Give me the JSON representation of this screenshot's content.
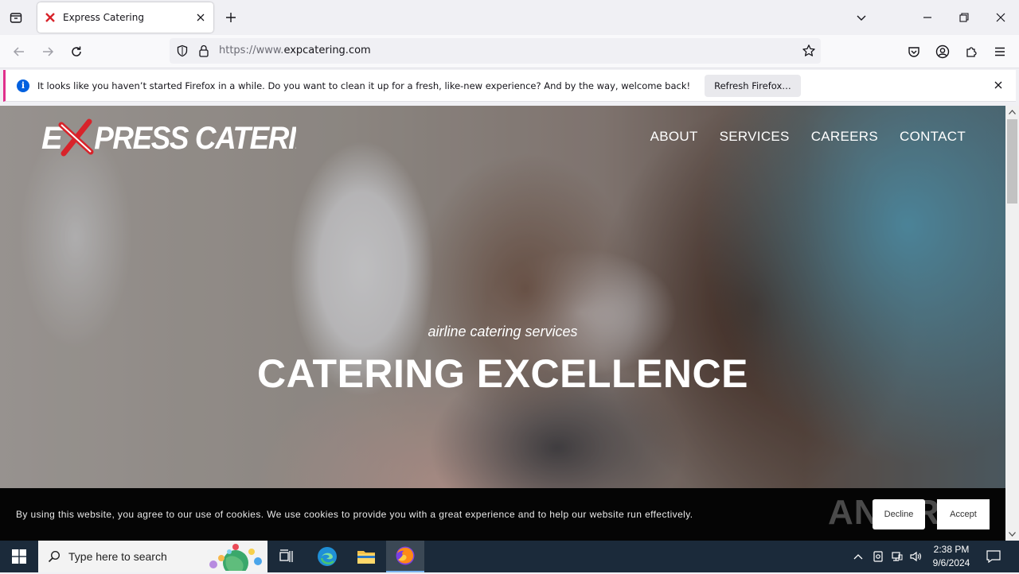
{
  "browser": {
    "tab_title": "Express Catering",
    "url_scheme": "https://www.",
    "url_host": "expcatering.com",
    "notification_text": "It looks like you haven’t started Firefox in a while. Do you want to clean it up for a fresh, like-new experience? And by the way, welcome back!",
    "notification_button": "Refresh Firefox…",
    "notification_accent": "#e0308c"
  },
  "site": {
    "logo_text": "EXPRESS CATERING",
    "logo_x_color": "#d8232a",
    "nav": [
      "ABOUT",
      "SERVICES",
      "CAREERS",
      "CONTACT"
    ],
    "hero_subtitle": "airline catering services",
    "hero_title": "CATERING EXCELLENCE"
  },
  "cookie_banner": {
    "text": "By using this website, you agree to our use of cookies. We use cookies to provide you with a great experience and to help our website run effectively.",
    "decline_label": "Decline",
    "accept_label": "Accept",
    "watermark": "ANY RUN"
  },
  "taskbar": {
    "search_placeholder": "Type here to search",
    "time": "2:38 PM",
    "date": "9/6/2024"
  }
}
